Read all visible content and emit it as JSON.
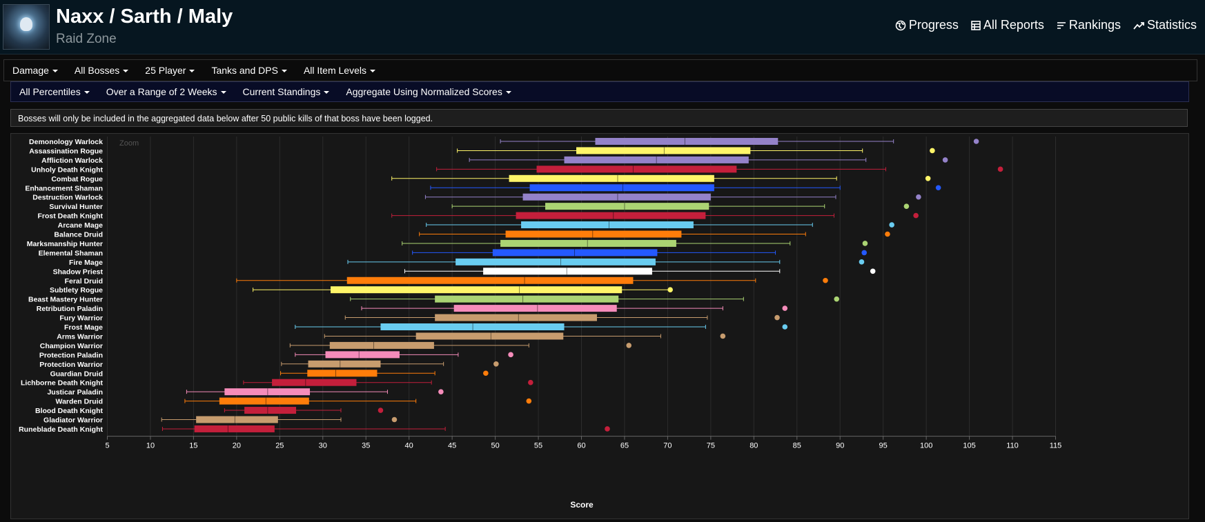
{
  "header": {
    "title": "Naxx / Sarth / Maly",
    "subtitle": "Raid Zone",
    "nav": [
      {
        "label": "Progress",
        "icon": "globe-icon"
      },
      {
        "label": "All Reports",
        "icon": "reports-icon"
      },
      {
        "label": "Rankings",
        "icon": "rankings-icon"
      },
      {
        "label": "Statistics",
        "icon": "statistics-icon"
      }
    ]
  },
  "filters_row1": [
    "Damage",
    "All Bosses",
    "25 Player",
    "Tanks and DPS",
    "All Item Levels"
  ],
  "filters_row2": [
    "All Percentiles",
    "Over a Range of 2 Weeks",
    "Current Standings",
    "Aggregate Using Normalized Scores"
  ],
  "notice": "Bosses will only be included in the aggregated data below after 50 public kills of that boss have been logged.",
  "zoom_label": "Zoom",
  "chart_data": {
    "type": "boxplot",
    "xlabel": "Score",
    "xlim": [
      5,
      115
    ],
    "xticks": [
      5,
      10,
      15,
      20,
      25,
      30,
      35,
      40,
      45,
      50,
      55,
      60,
      65,
      70,
      75,
      80,
      85,
      90,
      95,
      100,
      105,
      110,
      115
    ],
    "grid": true,
    "series": [
      {
        "name": "Demonology Warlock",
        "color": "#9482c9",
        "min": 50.6,
        "q1": 61.6,
        "median": 72.0,
        "q3": 82.8,
        "max": 96.2,
        "outlier": 105.8
      },
      {
        "name": "Assassination Rogue",
        "color": "#fff569",
        "min": 45.6,
        "q1": 59.4,
        "median": 69.6,
        "q3": 79.6,
        "max": 92.6,
        "outlier": 100.7
      },
      {
        "name": "Affliction Warlock",
        "color": "#9482c9",
        "min": 47.0,
        "q1": 58.0,
        "median": 68.7,
        "q3": 79.4,
        "max": 93.0,
        "outlier": 102.2
      },
      {
        "name": "Unholy Death Knight",
        "color": "#c41f3b",
        "min": 43.2,
        "q1": 54.8,
        "median": 66.0,
        "q3": 78.0,
        "max": 95.3,
        "outlier": 108.6
      },
      {
        "name": "Combat Rogue",
        "color": "#fff569",
        "min": 38.0,
        "q1": 51.6,
        "median": 64.2,
        "q3": 75.4,
        "max": 89.6,
        "outlier": 100.2
      },
      {
        "name": "Enhancement Shaman",
        "color": "#2459ff",
        "min": 42.5,
        "q1": 54.0,
        "median": 64.8,
        "q3": 75.4,
        "max": 90.0,
        "outlier": 101.4
      },
      {
        "name": "Destruction Warlock",
        "color": "#9482c9",
        "min": 41.9,
        "q1": 53.2,
        "median": 64.2,
        "q3": 75.0,
        "max": 89.5,
        "outlier": 99.1
      },
      {
        "name": "Survival Hunter",
        "color": "#abd473",
        "min": 45.0,
        "q1": 55.8,
        "median": 65.0,
        "q3": 74.8,
        "max": 88.2,
        "outlier": 97.7
      },
      {
        "name": "Frost Death Knight",
        "color": "#c41f3b",
        "min": 38.0,
        "q1": 52.4,
        "median": 63.7,
        "q3": 74.4,
        "max": 89.3,
        "outlier": 98.8
      },
      {
        "name": "Arcane Mage",
        "color": "#69ccf0",
        "min": 42.0,
        "q1": 53.0,
        "median": 63.2,
        "q3": 73.0,
        "max": 86.8,
        "outlier": 96.0
      },
      {
        "name": "Balance Druid",
        "color": "#ff7d0a",
        "min": 41.2,
        "q1": 51.2,
        "median": 61.3,
        "q3": 71.6,
        "max": 86.0,
        "outlier": 95.5
      },
      {
        "name": "Marksmanship Hunter",
        "color": "#abd473",
        "min": 39.2,
        "q1": 50.6,
        "median": 60.7,
        "q3": 71.0,
        "max": 84.2,
        "outlier": 92.9
      },
      {
        "name": "Elemental Shaman",
        "color": "#2459ff",
        "min": 40.4,
        "q1": 49.7,
        "median": 59.2,
        "q3": 68.8,
        "max": 82.5,
        "outlier": 92.8
      },
      {
        "name": "Fire Mage",
        "color": "#69ccf0",
        "min": 32.9,
        "q1": 45.4,
        "median": 57.6,
        "q3": 68.6,
        "max": 83.0,
        "outlier": 92.5
      },
      {
        "name": "Shadow Priest",
        "color": "#ffffff",
        "min": 39.5,
        "q1": 48.6,
        "median": 58.3,
        "q3": 68.2,
        "max": 83.0,
        "outlier": 93.8
      },
      {
        "name": "Feral Druid",
        "color": "#ff7d0a",
        "min": 20.0,
        "q1": 32.8,
        "median": 53.4,
        "q3": 66.0,
        "max": 80.2,
        "outlier": 88.3
      },
      {
        "name": "Subtlety Rogue",
        "color": "#fff569",
        "min": 21.9,
        "q1": 30.9,
        "median": 52.8,
        "q3": 64.7,
        "max": 70.3,
        "outlier": 70.3
      },
      {
        "name": "Beast Mastery Hunter",
        "color": "#abd473",
        "min": 33.2,
        "q1": 43.0,
        "median": 53.2,
        "q3": 64.3,
        "max": 78.8,
        "outlier": 89.6
      },
      {
        "name": "Retribution Paladin",
        "color": "#f58cba",
        "min": 34.5,
        "q1": 45.2,
        "median": 54.9,
        "q3": 64.1,
        "max": 76.4,
        "outlier": 83.6
      },
      {
        "name": "Fury Warrior",
        "color": "#c79c6e",
        "min": 32.6,
        "q1": 43.0,
        "median": 52.7,
        "q3": 61.8,
        "max": 74.6,
        "outlier": 82.7
      },
      {
        "name": "Frost Mage",
        "color": "#69ccf0",
        "min": 26.8,
        "q1": 36.7,
        "median": 47.4,
        "q3": 58.0,
        "max": 74.4,
        "outlier": 83.6
      },
      {
        "name": "Arms Warrior",
        "color": "#c79c6e",
        "min": 30.2,
        "q1": 40.8,
        "median": 49.5,
        "q3": 57.9,
        "max": 69.2,
        "outlier": 76.4
      },
      {
        "name": "Champion Warrior",
        "color": "#c79c6e",
        "min": 26.2,
        "q1": 30.8,
        "median": 35.9,
        "q3": 42.9,
        "max": 53.9,
        "outlier": 65.5
      },
      {
        "name": "Protection Paladin",
        "color": "#f58cba",
        "min": 26.8,
        "q1": 30.3,
        "median": 34.2,
        "q3": 38.9,
        "max": 45.7,
        "outlier": 51.8
      },
      {
        "name": "Protection Warrior",
        "color": "#c79c6e",
        "min": 25.2,
        "q1": 28.3,
        "median": 32.0,
        "q3": 36.7,
        "max": 44.0,
        "outlier": 50.1
      },
      {
        "name": "Guardian Druid",
        "color": "#ff7d0a",
        "min": 25.1,
        "q1": 28.2,
        "median": 31.5,
        "q3": 36.3,
        "max": 43.0,
        "outlier": 48.9
      },
      {
        "name": "Lichborne Death Knight",
        "color": "#c41f3b",
        "min": 20.8,
        "q1": 24.1,
        "median": 28.0,
        "q3": 33.9,
        "max": 42.6,
        "outlier": 54.1
      },
      {
        "name": "Justicar Paladin",
        "color": "#f58cba",
        "min": 14.2,
        "q1": 18.6,
        "median": 23.6,
        "q3": 28.5,
        "max": 37.5,
        "outlier": 43.7
      },
      {
        "name": "Warden Druid",
        "color": "#ff7d0a",
        "min": 14.0,
        "q1": 18.0,
        "median": 23.4,
        "q3": 28.4,
        "max": 40.8,
        "outlier": 53.9
      },
      {
        "name": "Blood Death Knight",
        "color": "#c41f3b",
        "min": 18.6,
        "q1": 20.9,
        "median": 23.6,
        "q3": 26.9,
        "max": 32.1,
        "outlier": 36.7
      },
      {
        "name": "Gladiator Warrior",
        "color": "#c79c6e",
        "min": 11.3,
        "q1": 15.3,
        "median": 19.8,
        "q3": 24.8,
        "max": 32.1,
        "outlier": 38.3
      },
      {
        "name": "Runeblade Death Knight",
        "color": "#c41f3b",
        "min": 11.4,
        "q1": 15.1,
        "median": 19.0,
        "q3": 24.4,
        "max": 44.2,
        "outlier": 63.0
      }
    ]
  }
}
